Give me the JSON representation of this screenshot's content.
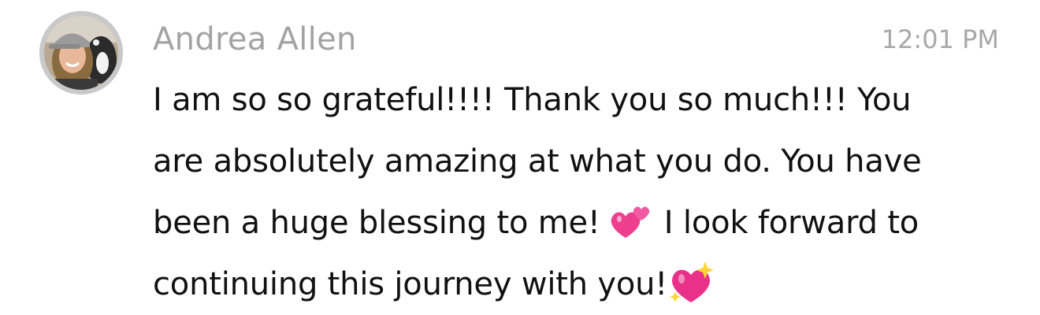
{
  "message": {
    "sender": "Andrea Allen",
    "timestamp": "12:01 PM",
    "text_lines": [
      "I am so so grateful!!!! Thank you so much!!! You",
      "are absolutely amazing at what you do. You have",
      "been a huge blessing to me! ",
      " I look forward to",
      "continuing this journey with you!"
    ],
    "emojis": {
      "first": "two-hearts-icon",
      "second": "sparkling-heart-icon"
    }
  },
  "colors": {
    "sender": "#a3a3a3",
    "timestamp": "#a8a8a8",
    "text": "#111111",
    "avatar_ring": "#c9c9c9",
    "heart_pink": "#ee3f8f"
  }
}
